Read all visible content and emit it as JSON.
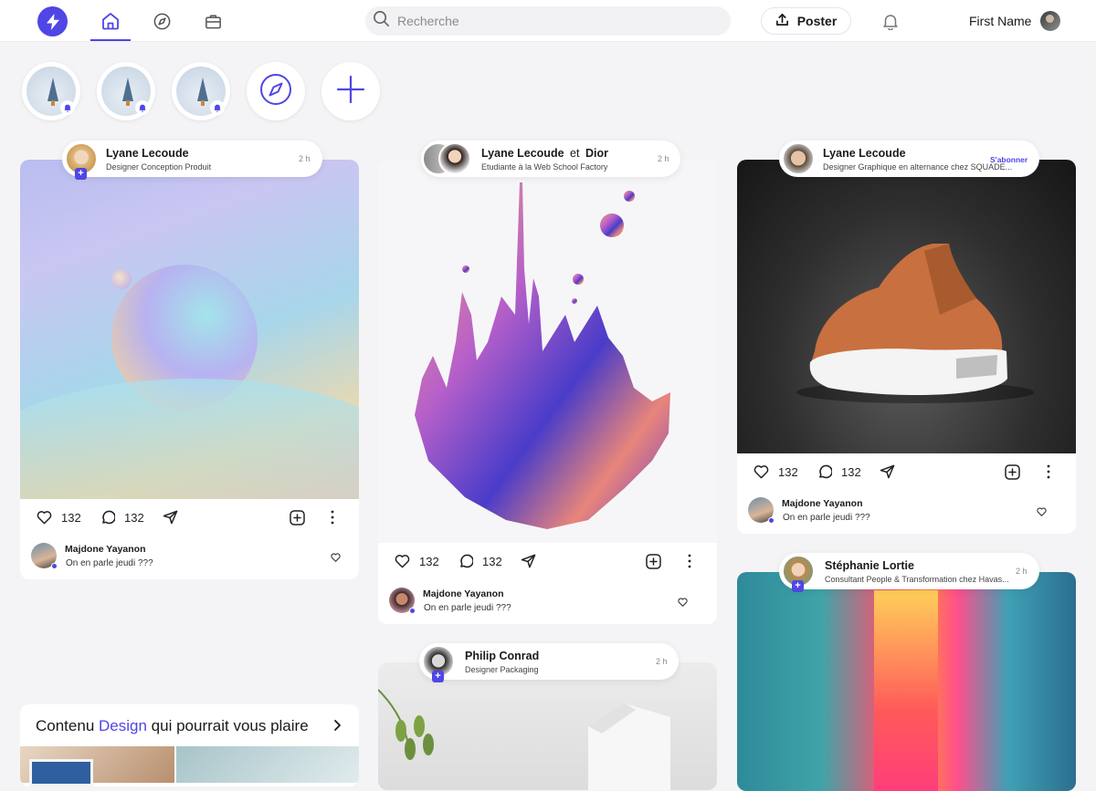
{
  "search": {
    "placeholder": "Recherche"
  },
  "header": {
    "post_label": "Poster",
    "user_name": "First Name"
  },
  "posts": [
    {
      "author": "Lyane Lecoude",
      "subtitle": "Designer Conception Produit",
      "time": "2 h",
      "likes": "132",
      "comments": "132",
      "comment_author": "Majdone Yayanon",
      "comment_text": "On en parle jeudi ???"
    },
    {
      "author": "Lyane Lecoude",
      "connector": "et",
      "coauthor": "Dior",
      "subtitle": "Etudiante à la Web School Factory",
      "time": "2 h",
      "likes": "132",
      "comments": "132",
      "comment_author": "Majdone Yayanon",
      "comment_text": "On en parle jeudi ???"
    },
    {
      "author": "Lyane Lecoude",
      "subtitle": "Designer Graphique en alternance chez SQUADE...",
      "follow_label": "S'abonner",
      "likes": "132",
      "comments": "132",
      "comment_author": "Majdone Yayanon",
      "comment_text": "On en parle jeudi ???"
    },
    {
      "author": "Philip Conrad",
      "subtitle": "Designer Packaging",
      "time": "2 h"
    },
    {
      "author": "Stéphanie Lortie",
      "subtitle": "Consultant People & Transformation chez Havas...",
      "time": "2 h"
    }
  ],
  "suggestions": {
    "prefix": "Contenu",
    "highlight": "Design",
    "suffix": "qui pourrait vous plaire"
  },
  "colors": {
    "accent": "#4f46e5",
    "background": "#f4f4f6",
    "card": "#ffffff"
  }
}
